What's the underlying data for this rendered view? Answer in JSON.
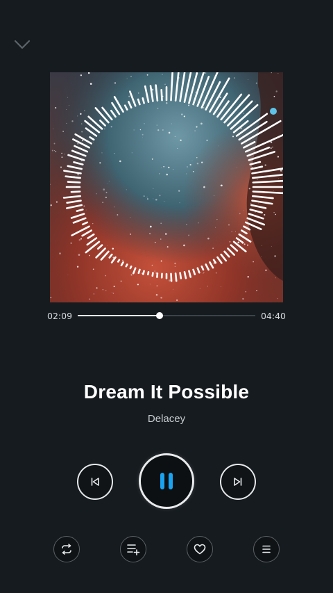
{
  "nav": {
    "collapse_icon": "chevron-down-icon"
  },
  "album_art": {
    "description_icon": "nebula-album-art"
  },
  "playback": {
    "elapsed": "02:09",
    "total": "04:40",
    "progress_fraction": 0.46
  },
  "track": {
    "title": "Dream It Possible",
    "artist": "Delacey"
  },
  "controls": {
    "previous_icon": "skip-previous-icon",
    "play_pause_icon": "pause-icon",
    "next_icon": "skip-next-icon"
  },
  "bottom_actions": {
    "repeat_icon": "repeat-icon",
    "add_to_playlist_icon": "add-to-playlist-icon",
    "favorite_icon": "heart-icon",
    "queue_icon": "queue-icon"
  },
  "colors": {
    "background": "#161b1f",
    "accent": "#1aa3f0",
    "text": "#ffffff"
  }
}
